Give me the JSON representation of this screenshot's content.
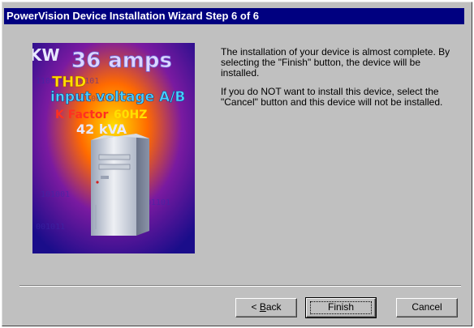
{
  "window": {
    "title": "PowerVision Device Installation Wizard Step 6 of 6"
  },
  "graphic": {
    "labels": {
      "kw": "KW",
      "amps": "36 amps",
      "thd": "THD",
      "voltage": "input voltage A/B",
      "factor": "K Factor",
      "hz": "60HZ",
      "kva": "42 kVA"
    }
  },
  "body": {
    "paragraph1": "The installation of your device is almost complete. By selecting the \"Finish\" button, the device will be installed.",
    "paragraph2": "If you do NOT want to install this device, select the \"Cancel\" button and this device will not be installed."
  },
  "buttons": {
    "back_prefix": "< ",
    "back_mnemonic": "B",
    "back_rest": "ack",
    "finish": "Finish",
    "cancel": "Cancel"
  }
}
